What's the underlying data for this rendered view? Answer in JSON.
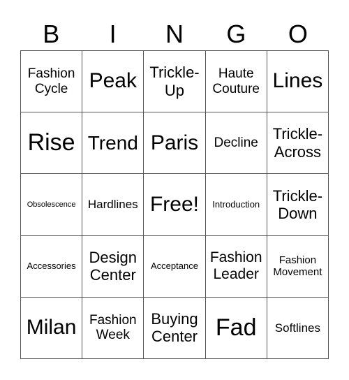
{
  "header": [
    "B",
    "I",
    "N",
    "G",
    "O"
  ],
  "cells": [
    "Fashion Cycle",
    "Peak",
    "Trickle-Up",
    "Haute Couture",
    "Lines",
    "Rise",
    "Trend",
    "Paris",
    "Decline",
    "Trickle-Across",
    "Obsolescence",
    "Hardlines",
    "Free!",
    "Introduction",
    "Trickle-Down",
    "Accessories",
    "Design Center",
    "Acceptance",
    "Fashion Leader",
    "Fashion Movement",
    "Milan",
    "Fashion Week",
    "Buying Center",
    "Fad",
    "Softlines"
  ]
}
